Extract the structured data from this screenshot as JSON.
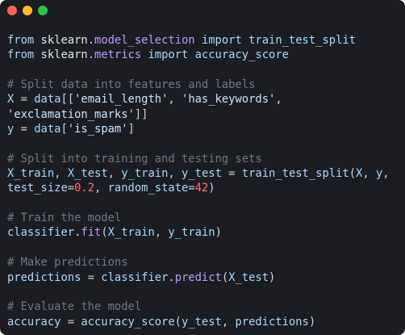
{
  "window": {
    "colors": {
      "background": "#1b1d22",
      "close": "#ff5f57",
      "minimize": "#febc2e",
      "maximize": "#28c840"
    }
  },
  "code": {
    "language": "python",
    "lines": [
      [
        [
          "id",
          "from"
        ],
        [
          "op",
          " "
        ],
        [
          "mod",
          "sklearn"
        ],
        [
          "op",
          "."
        ],
        [
          "attr",
          "model_selection"
        ],
        [
          "op",
          " "
        ],
        [
          "id",
          "import"
        ],
        [
          "op",
          " "
        ],
        [
          "id",
          "train_test_split"
        ]
      ],
      [
        [
          "id",
          "from"
        ],
        [
          "op",
          " "
        ],
        [
          "mod",
          "sklearn"
        ],
        [
          "op",
          "."
        ],
        [
          "attr",
          "metrics"
        ],
        [
          "op",
          " "
        ],
        [
          "id",
          "import"
        ],
        [
          "op",
          " "
        ],
        [
          "id",
          "accuracy_score"
        ]
      ],
      [],
      [
        [
          "cm",
          "# Split data into features and labels"
        ]
      ],
      [
        [
          "id",
          "X"
        ],
        [
          "op",
          " = "
        ],
        [
          "id",
          "data"
        ],
        [
          "op",
          "[["
        ],
        [
          "str",
          "'email_length'"
        ],
        [
          "op",
          ", "
        ],
        [
          "str",
          "'has_keywords'"
        ],
        [
          "op",
          ","
        ]
      ],
      [
        [
          "str",
          "'exclamation_marks'"
        ],
        [
          "op",
          "]]"
        ]
      ],
      [
        [
          "id",
          "y"
        ],
        [
          "op",
          " = "
        ],
        [
          "id",
          "data"
        ],
        [
          "op",
          "["
        ],
        [
          "str",
          "'is_spam'"
        ],
        [
          "op",
          "]"
        ]
      ],
      [],
      [
        [
          "cm",
          "# Split into training and testing sets"
        ]
      ],
      [
        [
          "id",
          "X_train"
        ],
        [
          "op",
          ", "
        ],
        [
          "id",
          "X_test"
        ],
        [
          "op",
          ", "
        ],
        [
          "id",
          "y_train"
        ],
        [
          "op",
          ", "
        ],
        [
          "id",
          "y_test"
        ],
        [
          "op",
          " = "
        ],
        [
          "id",
          "train_test_split"
        ],
        [
          "op",
          "("
        ],
        [
          "id",
          "X"
        ],
        [
          "op",
          ", "
        ],
        [
          "id",
          "y"
        ],
        [
          "op",
          ","
        ]
      ],
      [
        [
          "id",
          "test_size"
        ],
        [
          "op",
          "="
        ],
        [
          "num",
          "0.2"
        ],
        [
          "op",
          ", "
        ],
        [
          "id",
          "random_state"
        ],
        [
          "op",
          "="
        ],
        [
          "num",
          "42"
        ],
        [
          "op",
          ")"
        ]
      ],
      [],
      [
        [
          "cm",
          "# Train the model"
        ]
      ],
      [
        [
          "id",
          "classifier"
        ],
        [
          "op",
          "."
        ],
        [
          "attr",
          "fit"
        ],
        [
          "op",
          "("
        ],
        [
          "id",
          "X_train"
        ],
        [
          "op",
          ", "
        ],
        [
          "id",
          "y_train"
        ],
        [
          "op",
          ")"
        ]
      ],
      [],
      [
        [
          "cm",
          "# Make predictions"
        ]
      ],
      [
        [
          "id",
          "predictions"
        ],
        [
          "op",
          " = "
        ],
        [
          "id",
          "classifier"
        ],
        [
          "op",
          "."
        ],
        [
          "attr",
          "predict"
        ],
        [
          "op",
          "("
        ],
        [
          "id",
          "X_test"
        ],
        [
          "op",
          ")"
        ]
      ],
      [],
      [
        [
          "cm",
          "# Evaluate the model"
        ]
      ],
      [
        [
          "id",
          "accuracy"
        ],
        [
          "op",
          " = "
        ],
        [
          "id",
          "accuracy_score"
        ],
        [
          "op",
          "("
        ],
        [
          "id",
          "y_test"
        ],
        [
          "op",
          ", "
        ],
        [
          "id",
          "predictions"
        ],
        [
          "op",
          ")"
        ]
      ]
    ]
  }
}
